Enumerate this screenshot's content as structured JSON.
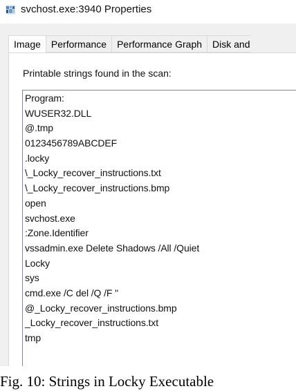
{
  "window": {
    "title": "svchost.exe:3940 Properties",
    "icon": "application-icon"
  },
  "tabs": [
    {
      "label": "Image",
      "selected": true
    },
    {
      "label": "Performance",
      "selected": false
    },
    {
      "label": "Performance Graph",
      "selected": false
    },
    {
      "label": "Disk and",
      "selected": false
    }
  ],
  "strings_panel": {
    "label": "Printable strings found in the scan:",
    "items": [
      "Program:",
      "WUSER32.DLL",
      "@.tmp",
      "0123456789ABCDEF",
      ".locky",
      "\\_Locky_recover_instructions.txt",
      "\\_Locky_recover_instructions.bmp",
      "open",
      "svchost.exe",
      ":Zone.Identifier",
      "vssadmin.exe Delete Shadows /All /Quiet",
      "Locky",
      "sys",
      "cmd.exe /C del /Q /F \"",
      "@_Locky_recover_instructions.bmp",
      "_Locky_recover_instructions.txt",
      "tmp"
    ]
  },
  "caption": "Fig. 10: Strings in Locky Executable"
}
